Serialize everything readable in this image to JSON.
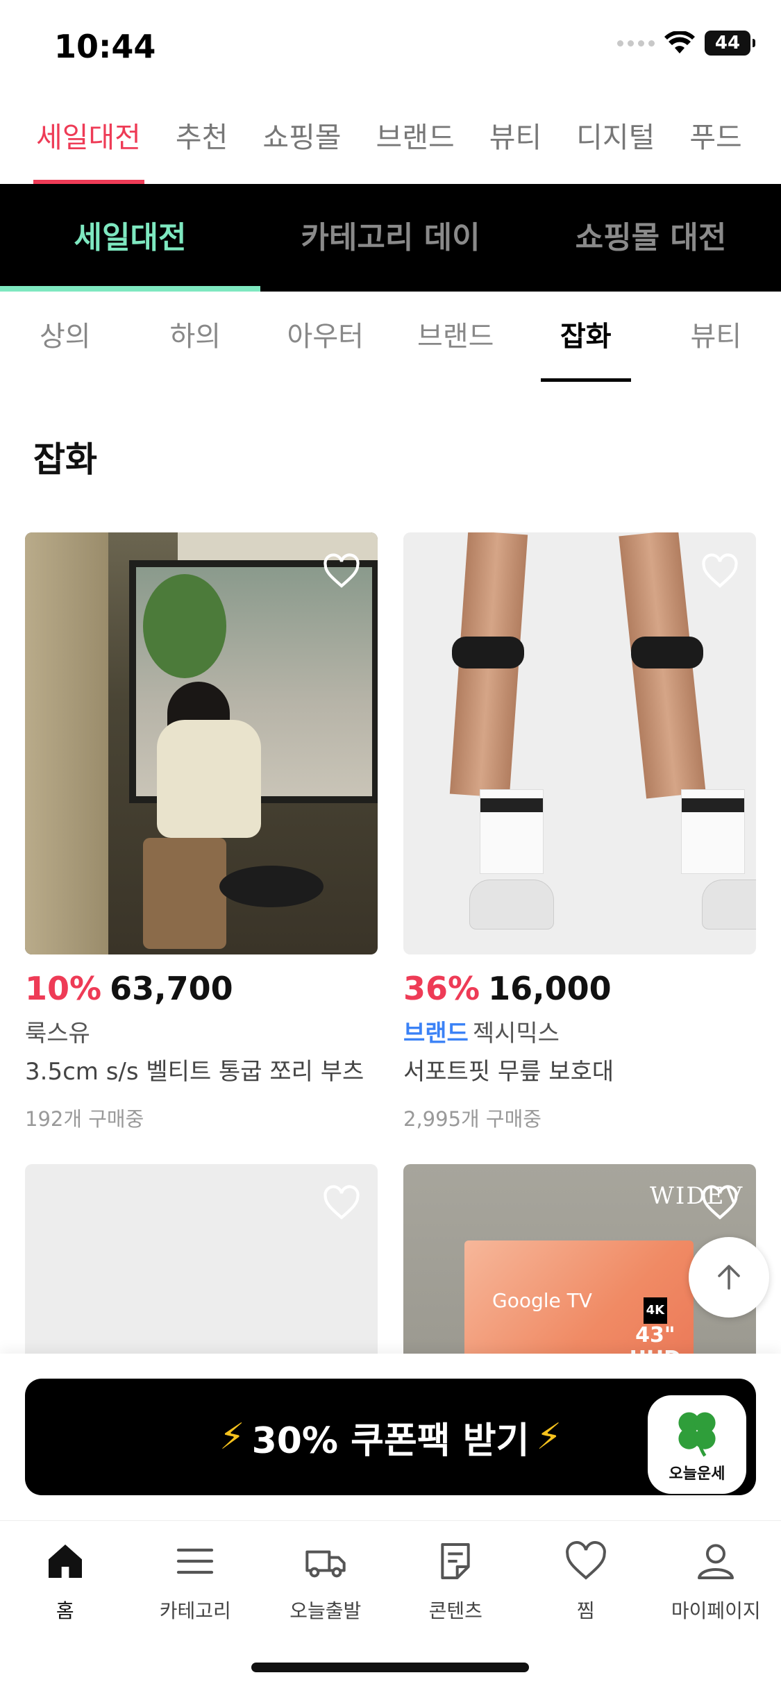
{
  "status": {
    "time": "10:44",
    "battery": "44"
  },
  "top_tabs": [
    "세일대전",
    "추천",
    "쇼핑몰",
    "브랜드",
    "뷰티",
    "디지털",
    "푸드"
  ],
  "top_tabs_active": 0,
  "sub_tabs": [
    "세일대전",
    "카테고리 데이",
    "쇼핑몰 대전"
  ],
  "category_tabs": [
    "상의",
    "하의",
    "아우터",
    "브랜드",
    "잡화",
    "뷰티"
  ],
  "section_title": "잡화",
  "products": [
    {
      "discount": "10%",
      "price": "63,700",
      "brand_badge": "",
      "brand": "룩스유",
      "name": "3.5cm s/s 벨티트 통굽 쪼리 부츠",
      "sold": "192개 구매중"
    },
    {
      "discount": "36%",
      "price": "16,000",
      "brand_badge": "브랜드",
      "brand": "젝시믹스",
      "name": "서포트핏 무릎 보호대",
      "sold": "2,995개 구매중"
    }
  ],
  "tv_card": {
    "brand": "WIDEV",
    "tv_text": "Google TV",
    "tv_size": "43\"",
    "tv_uhd": "UHD",
    "badge": "4K"
  },
  "coupon": {
    "label": "30% 쿠폰팩 받기",
    "bolt": "⚡"
  },
  "fortune": {
    "label": "오늘운세"
  },
  "nav": [
    "홈",
    "카테고리",
    "오늘출발",
    "콘텐츠",
    "찜",
    "마이페이지"
  ],
  "colors": {
    "accent": "#ee3b56",
    "mint": "#7ee8c0",
    "brand_blue": "#3b82f6"
  }
}
